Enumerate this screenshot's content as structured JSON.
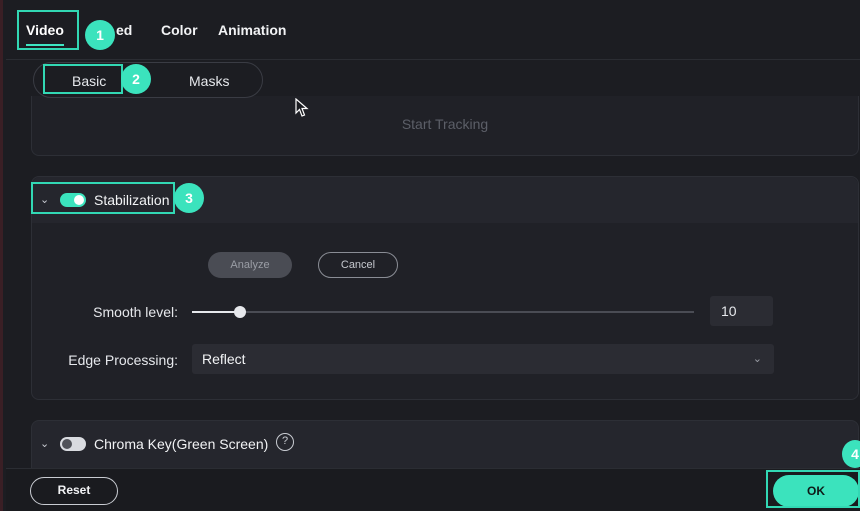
{
  "top_tabs": {
    "video": "Video",
    "speed": "ed",
    "color": "Color",
    "animation": "Animation"
  },
  "sub_tabs": {
    "basic": "Basic",
    "masks": "Masks"
  },
  "tracking": {
    "start_label": "Start Tracking"
  },
  "stabilization": {
    "title": "Stabilization",
    "enabled": true,
    "analyze_label": "Analyze",
    "cancel_label": "Cancel",
    "smooth_label": "Smooth level:",
    "smooth_value": "10",
    "smooth_fraction": 0.095,
    "edge_label": "Edge Processing:",
    "edge_value": "Reflect"
  },
  "chroma": {
    "title": "Chroma Key(Green Screen)",
    "enabled": false,
    "help": "?"
  },
  "bottom": {
    "reset_label": "Reset",
    "ok_label": "OK"
  },
  "markers": {
    "m1": "1",
    "m2": "2",
    "m3": "3",
    "m4": "4"
  },
  "colors": {
    "accent": "#3be3bd",
    "background": "#1c1d22",
    "panel": "#202127"
  }
}
